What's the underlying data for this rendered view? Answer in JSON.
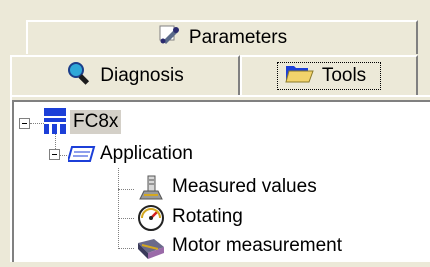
{
  "tabs": {
    "parameters": "Parameters",
    "diagnosis": "Diagnosis",
    "tools": "Tools"
  },
  "tree": {
    "root": "FC8x",
    "application": "Application",
    "items": [
      "Measured values",
      "Rotating",
      "Motor measurement"
    ]
  },
  "colors": {
    "face": "#ece9d8",
    "selection": "#d4d0c8",
    "accent_blue": "#1c3fd8"
  }
}
